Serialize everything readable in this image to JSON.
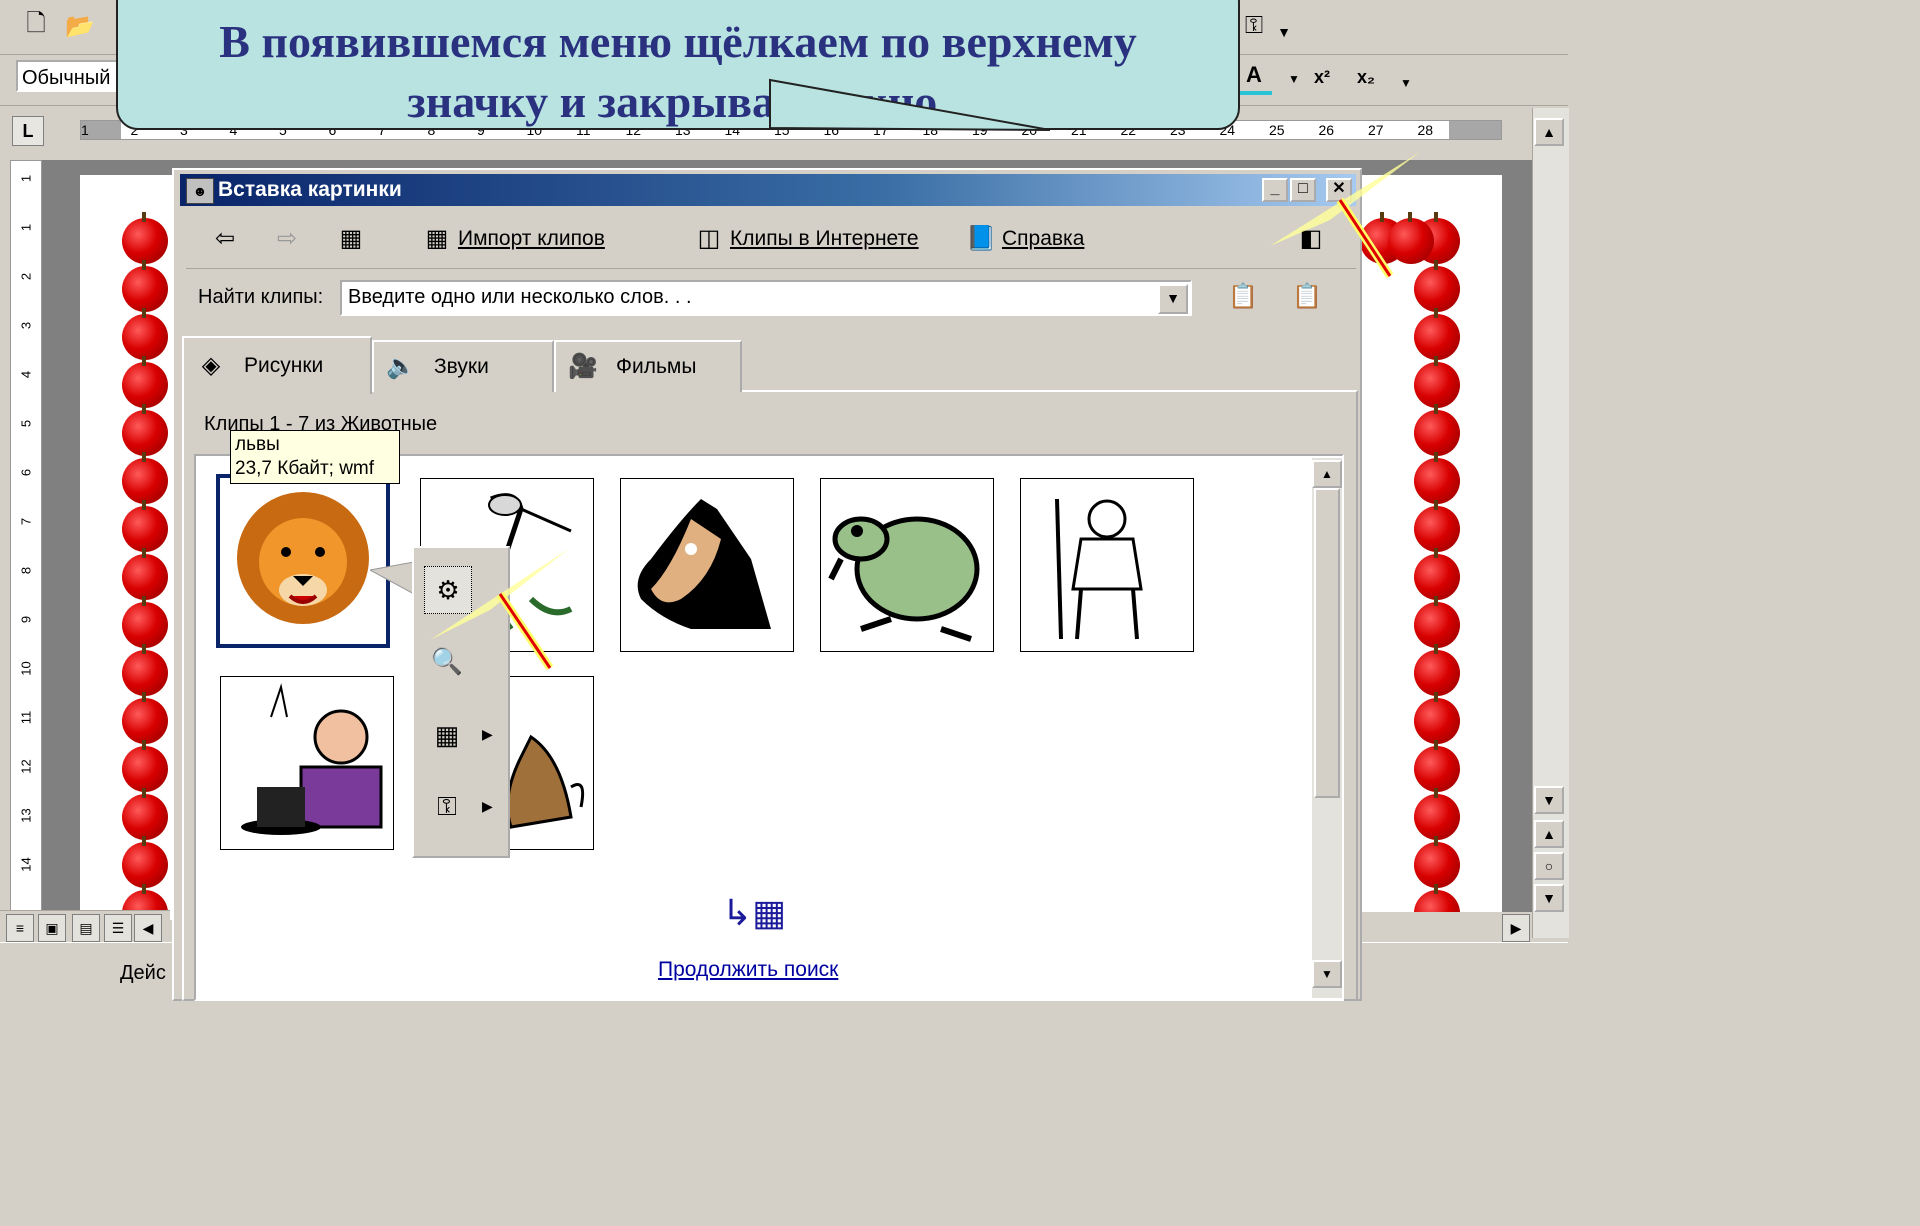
{
  "word": {
    "style_value": "Обычный",
    "status_draw_label": "Дейс"
  },
  "ruler": {
    "ticks": [
      "1",
      "2",
      "3",
      "4",
      "5",
      "6",
      "7",
      "8",
      "9",
      "10",
      "11",
      "12",
      "13",
      "14",
      "15",
      "16",
      "17",
      "18",
      "19",
      "20",
      "21",
      "22",
      "23",
      "24",
      "25",
      "26",
      "27",
      "28"
    ],
    "vticks": [
      "1",
      "1",
      "2",
      "3",
      "4",
      "5",
      "6",
      "7",
      "8",
      "9",
      "10",
      "11",
      "12",
      "13",
      "14"
    ]
  },
  "callout": {
    "line1": "В появившемся меню щёлкаем по верхнему",
    "line2": "значку и закрываем окно."
  },
  "dialog": {
    "title": "Вставка картинки",
    "toolbar": {
      "import_label": "Импорт клипов",
      "web_label": "Клипы в Интернете",
      "help_label": "Справка"
    },
    "find_label": "Найти клипы:",
    "find_value": "Введите одно или несколько слов. . .",
    "tabs": [
      {
        "label": "Рисунки",
        "icon": "pictures-icon"
      },
      {
        "label": "Звуки",
        "icon": "sounds-icon"
      },
      {
        "label": "Фильмы",
        "icon": "movies-icon"
      }
    ],
    "clips_caption": "Клипы 1 - 7 из Животные",
    "tooltip": {
      "name": "львы",
      "info": "23,7 Кбайт; wmf"
    },
    "clips": [
      "lion-clip",
      "heron-clip",
      "horse-clip",
      "frog-clip",
      "hunter-clip",
      "magician-clip",
      "dog-clip"
    ],
    "popup_items": [
      "insert-clip-icon",
      "preview-clip-icon",
      "add-to-category-icon",
      "find-similar-icon"
    ],
    "more_link": "Продолжить поиск"
  },
  "colors": {
    "callout_bg": "#b8e3e1",
    "callout_text": "#2a3280",
    "title_start": "#0a246a",
    "title_end": "#a6caf0",
    "apple": "#d80000"
  }
}
